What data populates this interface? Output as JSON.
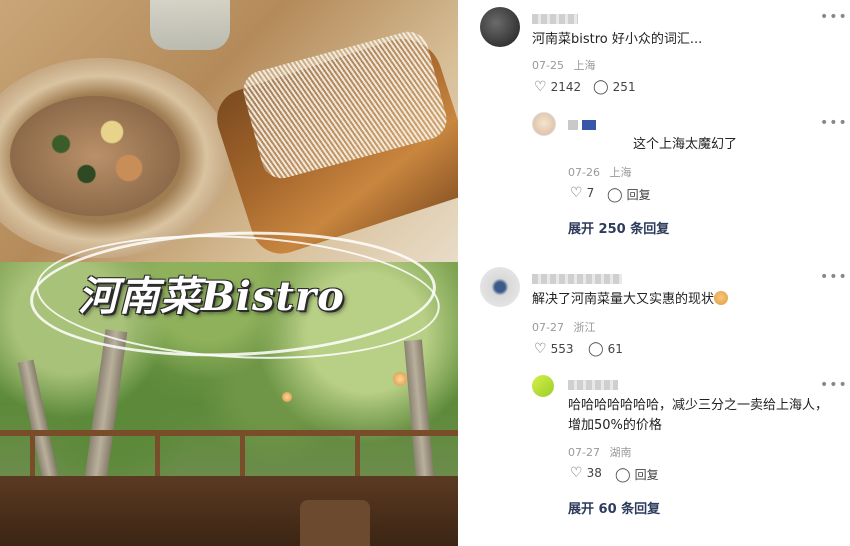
{
  "photo": {
    "title": "河南菜Bistro"
  },
  "comments": [
    {
      "text": "河南菜bistro 好小众的词汇...",
      "date": "07-25",
      "location": "上海",
      "likes": "2142",
      "replies_count": "251"
    },
    {
      "text": "这个上海太魔幻了",
      "date": "07-26",
      "location": "上海",
      "likes": "7",
      "reply_label": "回复"
    },
    {
      "expand_label": "展开 250 条回复"
    },
    {
      "text": "解决了河南菜量大又实惠的现状",
      "date": "07-27",
      "location": "浙江",
      "likes": "553",
      "replies_count": "61"
    },
    {
      "text_line1": "哈哈哈哈哈哈哈，减少三分之一卖给上海人，",
      "text_line2": "增加50%的价格",
      "date": "07-27",
      "location": "湖南",
      "likes": "38",
      "reply_label": "回复"
    },
    {
      "expand_label": "展开 60 条回复"
    }
  ],
  "icons": {
    "more": "more-icon",
    "like": "heart-icon",
    "reply": "comment-icon"
  },
  "colors": {
    "expand_text": "#2d3b5c",
    "meta_text": "#999999"
  }
}
